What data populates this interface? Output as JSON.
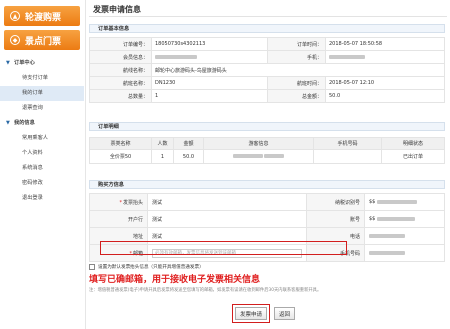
{
  "sidebar": {
    "btn1": "轮渡购票",
    "btn2": "景点门票",
    "items": [
      {
        "label": "订单中心"
      },
      {
        "label": "待支付订单"
      },
      {
        "label": "我的订单"
      },
      {
        "label": "退票查询"
      },
      {
        "label": "我的信息"
      },
      {
        "label": "常用乘客人"
      },
      {
        "label": "个人资料"
      },
      {
        "label": "系统消息"
      },
      {
        "label": "密码修改"
      },
      {
        "label": "退出登录"
      }
    ]
  },
  "page": {
    "title": "发票申请信息"
  },
  "order": {
    "section": "订单基本信息",
    "labels": {
      "order_no": "订单编号：",
      "order_time": "订单时间：",
      "member": "会员信息：",
      "mobile": "手机：",
      "route": "航线名称：",
      "flight": "航班名称：",
      "depart": "航班时间：",
      "total": "总数量：",
      "total_amount": "总金额："
    },
    "order_no": "18050730s4302113",
    "order_time": "2018-05-07 18:50:58",
    "route": "邮轮中心旅游码头-鸟屋旅游码头",
    "flight": "DN1230",
    "depart": "2018-05-07 12:10",
    "total": "1",
    "total_amount": "50.0"
  },
  "tickets": {
    "section": "订单明细",
    "headers": [
      "票类名称",
      "人数",
      "金额",
      "游客信息",
      "手机号码",
      "明细状态"
    ],
    "rows": [
      {
        "name": "全价票50",
        "count": "1",
        "amount": "50.0",
        "status": "已出订单"
      }
    ]
  },
  "buyer": {
    "section": "购买方信息",
    "title_label": "发票抬头",
    "title_value": "测试",
    "taxid_label": "纳税识别号",
    "taxid_value": "$$",
    "bank_label": "开户行",
    "bank_value": "测试",
    "account_label": "账号",
    "account_value": "$$",
    "addr_label": "地址",
    "addr_value": "测试",
    "phone_label": "电话",
    "email_label": "邮箱",
    "email_placeholder": "必须有效邮箱，发票信息将发送到该邮箱",
    "mobile_label": "手机号码"
  },
  "check_label": "设置为默认发票抬头信息（只能开具增值普通发票）",
  "annotation": "填写已确邮箱，用于接收电子发票相关信息",
  "note": "注：增值税普通发票(电子)申请开具后发票将发送至您填写的邮箱，如发票有误请在收到邮件后30天内联系客服重新开具。",
  "buttons": {
    "submit": "发票申请",
    "back": "返回"
  },
  "colors": {
    "accent": "#ec7b13",
    "highlight": "#d21e1e",
    "section_bg": "#f0f5fb"
  }
}
